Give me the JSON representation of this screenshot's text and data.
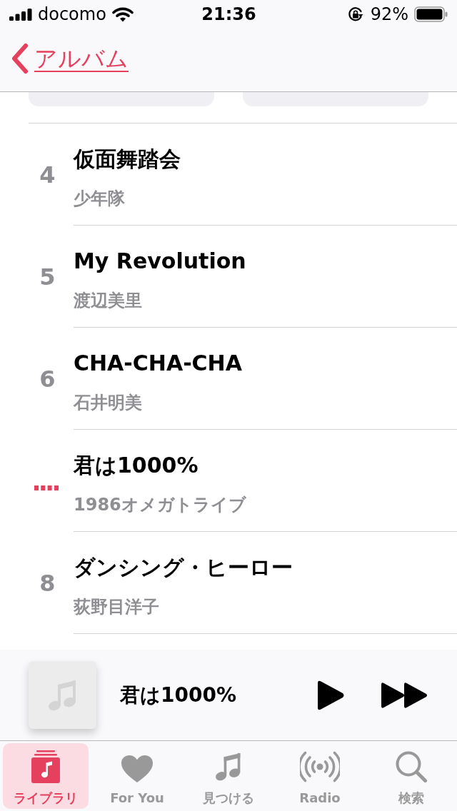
{
  "status_bar": {
    "carrier": "docomo",
    "time": "21:36",
    "battery": "92%"
  },
  "nav_bar": {
    "back_label": "アルバム"
  },
  "tracks": [
    {
      "number": "4",
      "title": "仮面舞踏会",
      "artist": "少年隊",
      "playing": false
    },
    {
      "number": "5",
      "title": "My Revolution",
      "artist": "渡辺美里",
      "playing": false
    },
    {
      "number": "6",
      "title": "CHA-CHA-CHA",
      "artist": "石井明美",
      "playing": false
    },
    {
      "title": "君は1000%",
      "artist": "1986オメガトライブ",
      "playing": true
    },
    {
      "number": "8",
      "title": "ダンシング・ヒーロー",
      "artist": "荻野目洋子",
      "playing": false
    }
  ],
  "mini_player": {
    "title": "君は1000%"
  },
  "tab_bar": [
    {
      "label": "ライブラリ",
      "kind": "library",
      "selected": true
    },
    {
      "label": "For You",
      "kind": "heart",
      "selected": false
    },
    {
      "label": "見つける",
      "kind": "note",
      "selected": false
    },
    {
      "label": "Radio",
      "kind": "radio",
      "selected": false
    },
    {
      "label": "検索",
      "kind": "search",
      "selected": false
    }
  ]
}
